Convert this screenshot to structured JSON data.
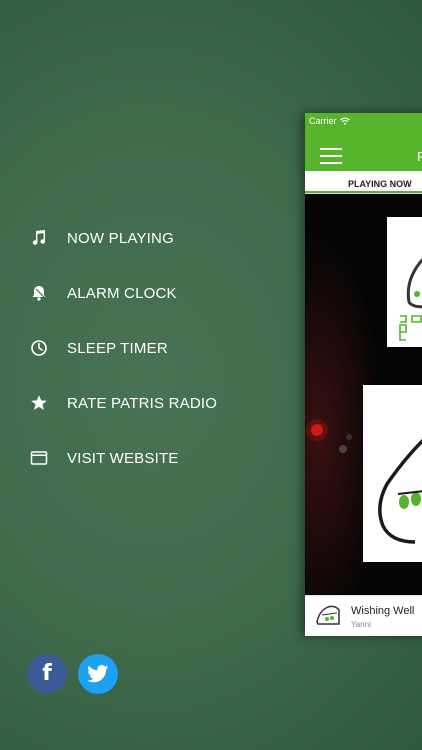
{
  "menu": {
    "items": [
      {
        "label": "NOW PLAYING",
        "icon": "music-note-icon"
      },
      {
        "label": "ALARM CLOCK",
        "icon": "bell-icon"
      },
      {
        "label": "SLEEP TIMER",
        "icon": "clock-icon"
      },
      {
        "label": "RATE PATRIS RADIO",
        "icon": "star-icon"
      },
      {
        "label": "VISIT WEBSITE",
        "icon": "browser-window-icon"
      }
    ]
  },
  "social": {
    "facebook": {
      "label": "f",
      "icon": "facebook-icon",
      "color": "#3b5b97"
    },
    "twitter": {
      "icon": "twitter-icon",
      "color": "#1da1f2"
    }
  },
  "app": {
    "status": {
      "carrier": "Carrier",
      "signal_icon": "wifi-icon"
    },
    "navbar": {
      "title": "P",
      "accent": "#57b52c"
    },
    "tab": {
      "label": "PLAYING NOW"
    },
    "now_playing": {
      "title": "Wishing Well",
      "artist": "Yanni"
    }
  }
}
